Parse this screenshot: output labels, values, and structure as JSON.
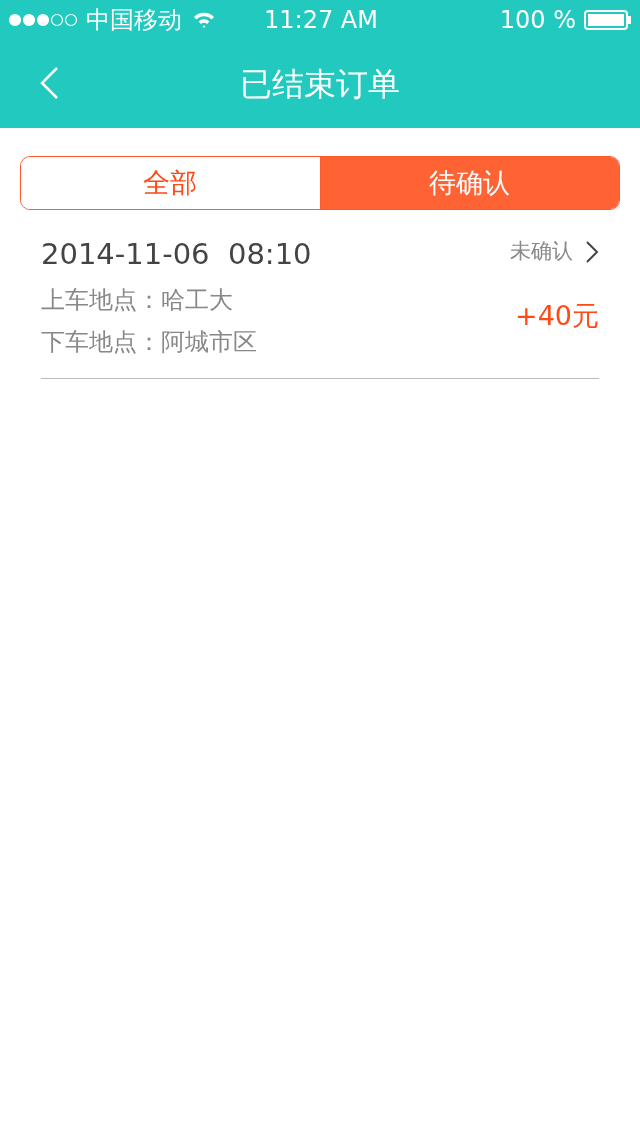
{
  "status_bar": {
    "carrier": "中国移动",
    "time": "11:27 AM",
    "battery": "100 %"
  },
  "nav": {
    "title": "已结束订单"
  },
  "tabs": [
    {
      "label": "全部",
      "selected": false
    },
    {
      "label": "待确认",
      "selected": true
    }
  ],
  "orders": [
    {
      "datetime": "2014-11-06  08:10",
      "status": "未确认",
      "pickup_label": "上车地点：",
      "pickup": "哈工大",
      "dropoff_label": "下车地点：",
      "dropoff": "阿城市区",
      "amount": "+40元"
    }
  ]
}
